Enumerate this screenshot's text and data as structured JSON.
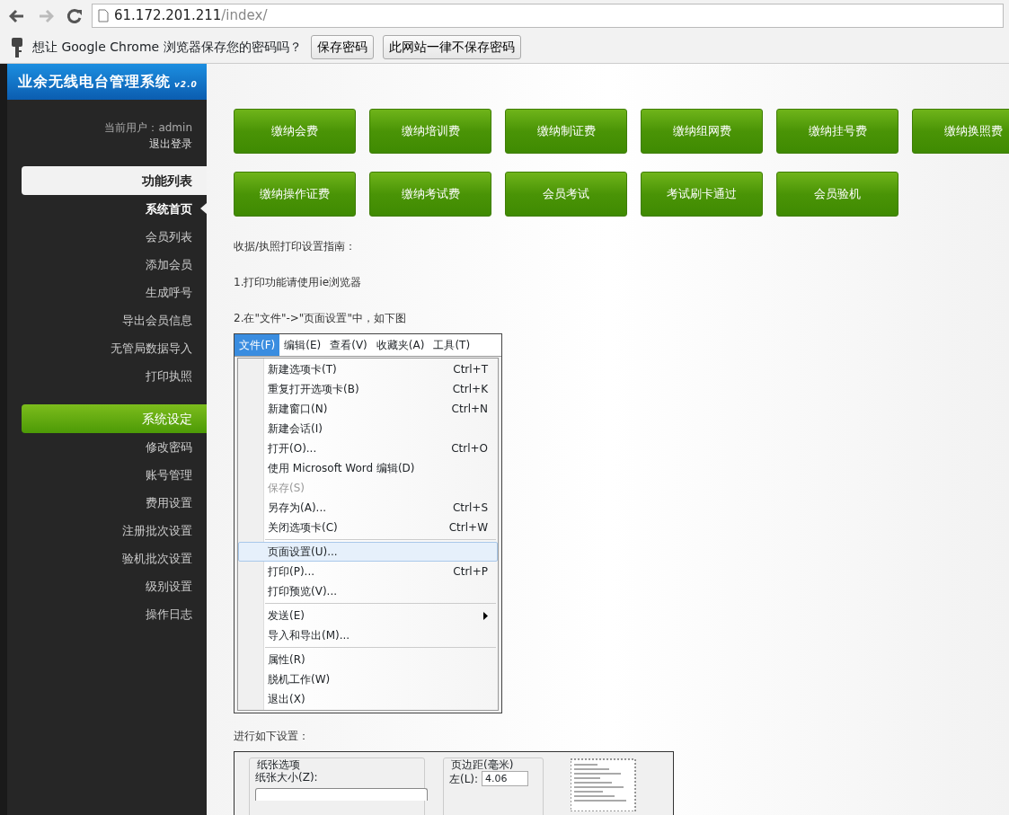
{
  "browser": {
    "url_host": "61.172.201.211",
    "url_path": "/index/",
    "infobar": {
      "message": "想让 Google Chrome 浏览器保存您的密码吗？",
      "buttons": [
        "保存密码",
        "此网站一律不保存密码"
      ]
    }
  },
  "sidebar": {
    "title": "业余无线电台管理系统",
    "version": "v2.0",
    "user_label": "当前用户：admin",
    "logout": "退出登录",
    "sections": [
      {
        "title": "功能列表",
        "active": true,
        "items": [
          {
            "label": "系统首页",
            "selected": true
          },
          {
            "label": "会员列表",
            "selected": false
          },
          {
            "label": "添加会员",
            "selected": false
          },
          {
            "label": "生成呼号",
            "selected": false
          },
          {
            "label": "导出会员信息",
            "selected": false
          },
          {
            "label": "无管局数据导入",
            "selected": false
          },
          {
            "label": "打印执照",
            "selected": false
          }
        ]
      },
      {
        "title": "系统设定",
        "active": false,
        "items": [
          {
            "label": "修改密码",
            "selected": false
          },
          {
            "label": "账号管理",
            "selected": false
          },
          {
            "label": "费用设置",
            "selected": false
          },
          {
            "label": "注册批次设置",
            "selected": false
          },
          {
            "label": "验机批次设置",
            "selected": false
          },
          {
            "label": "级别设置",
            "selected": false
          },
          {
            "label": "操作日志",
            "selected": false
          }
        ]
      }
    ]
  },
  "actions": [
    "缴纳会费",
    "缴纳培训费",
    "缴纳制证费",
    "缴纳组网费",
    "缴纳挂号费",
    "缴纳换照费",
    "缴纳操作证费",
    "缴纳考试费",
    "会员考试",
    "考试刷卡通过",
    "会员验机"
  ],
  "guide": {
    "lines": [
      "收据/执照打印设置指南：",
      "1.打印功能请使用ie浏览器",
      "2.在\"文件\"->\"页面设置\"中，如下图"
    ],
    "menu_screenshot": {
      "menubar": [
        {
          "label": "文件(F)",
          "selected": true
        },
        {
          "label": "编辑(E)",
          "selected": false
        },
        {
          "label": "查看(V)",
          "selected": false
        },
        {
          "label": "收藏夹(A)",
          "selected": false
        },
        {
          "label": "工具(T)",
          "selected": false
        }
      ],
      "items": [
        {
          "kind": "item",
          "label": "新建选项卡(T)",
          "shortcut": "Ctrl+T",
          "disabled": false,
          "highlighted": false
        },
        {
          "kind": "item",
          "label": "重复打开选项卡(B)",
          "shortcut": "Ctrl+K",
          "disabled": false,
          "highlighted": false
        },
        {
          "kind": "item",
          "label": "新建窗口(N)",
          "shortcut": "Ctrl+N",
          "disabled": false,
          "highlighted": false
        },
        {
          "kind": "item",
          "label": "新建会话(I)",
          "disabled": false,
          "highlighted": false
        },
        {
          "kind": "item",
          "label": "打开(O)...",
          "shortcut": "Ctrl+O",
          "disabled": false,
          "highlighted": false
        },
        {
          "kind": "item",
          "label": "使用 Microsoft Word 编辑(D)",
          "disabled": false,
          "highlighted": false
        },
        {
          "kind": "item",
          "label": "保存(S)",
          "disabled": true,
          "highlighted": false
        },
        {
          "kind": "item",
          "label": "另存为(A)...",
          "shortcut": "Ctrl+S",
          "disabled": false,
          "highlighted": false
        },
        {
          "kind": "item",
          "label": "关闭选项卡(C)",
          "shortcut": "Ctrl+W",
          "disabled": false,
          "highlighted": false
        },
        {
          "kind": "separator"
        },
        {
          "kind": "item",
          "label": "页面设置(U)...",
          "disabled": false,
          "highlighted": true
        },
        {
          "kind": "item",
          "label": "打印(P)...",
          "shortcut": "Ctrl+P",
          "disabled": false,
          "highlighted": false
        },
        {
          "kind": "item",
          "label": "打印预览(V)...",
          "disabled": false,
          "highlighted": false
        },
        {
          "kind": "separator"
        },
        {
          "kind": "submenu",
          "label": "发送(E)",
          "disabled": false,
          "highlighted": false
        },
        {
          "kind": "item",
          "label": "导入和导出(M)...",
          "disabled": false,
          "highlighted": false
        },
        {
          "kind": "separator"
        },
        {
          "kind": "item",
          "label": "属性(R)",
          "disabled": false,
          "highlighted": false
        },
        {
          "kind": "item",
          "label": "脱机工作(W)",
          "disabled": false,
          "highlighted": false
        },
        {
          "kind": "item",
          "label": "退出(X)",
          "disabled": false,
          "highlighted": false
        }
      ]
    },
    "setup_caption": "进行如下设置：",
    "page_setup": {
      "paper_group": "纸张选项",
      "paper_size_label": "纸张大小(Z):",
      "margins_group": "页边距(毫米)",
      "left_label": "左(L):",
      "left_value": "4.06"
    }
  }
}
